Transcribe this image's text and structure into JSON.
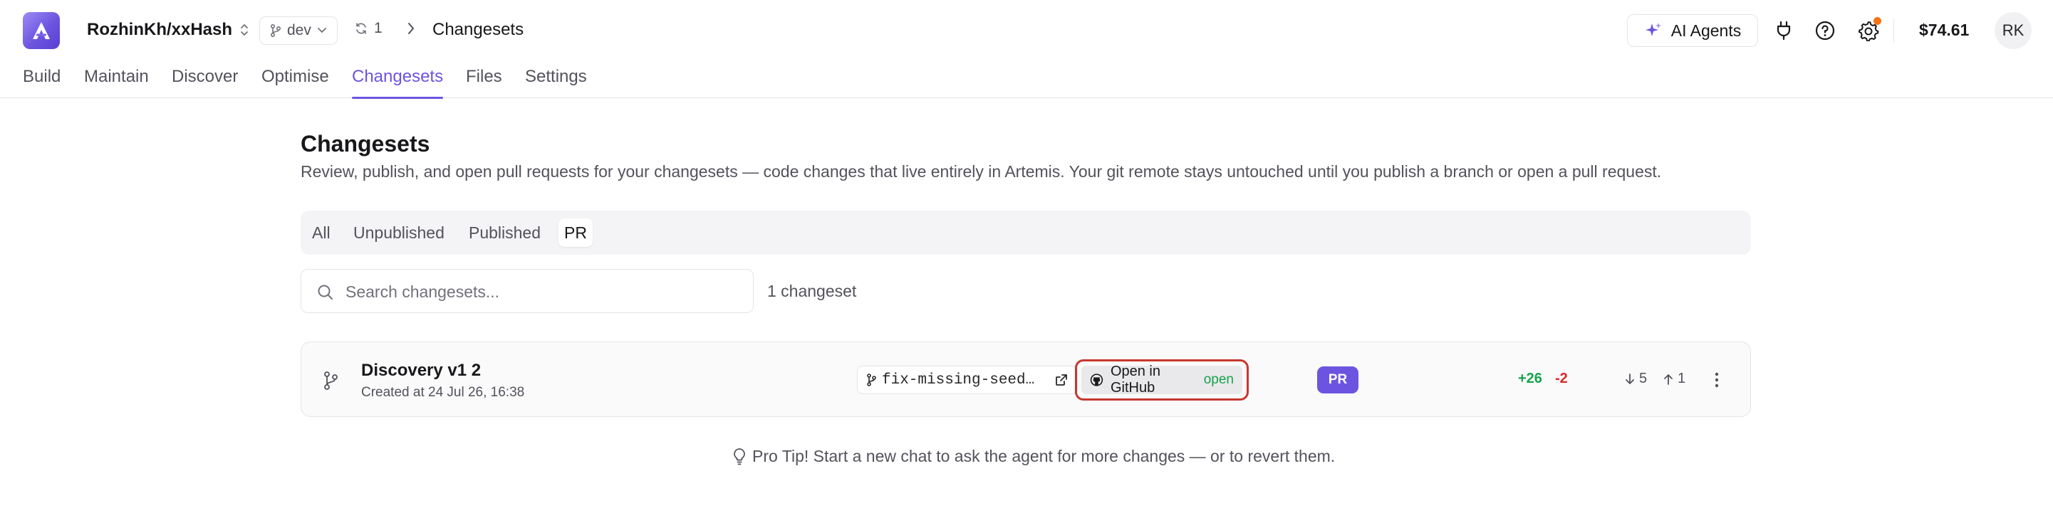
{
  "topbar": {
    "project_name": "RozhinKh/xxHash",
    "branch": "dev",
    "sync_count": "1",
    "breadcrumb_current": "Changesets",
    "ai_agents_label": "AI Agents",
    "balance": "$74.61",
    "avatar_initials": "RK",
    "notification_color": "#f97316"
  },
  "nav": {
    "tabs": [
      {
        "label": "Build"
      },
      {
        "label": "Maintain"
      },
      {
        "label": "Discover"
      },
      {
        "label": "Optimise"
      },
      {
        "label": "Changesets",
        "active": true
      },
      {
        "label": "Files"
      },
      {
        "label": "Settings"
      }
    ]
  },
  "main": {
    "title": "Changesets",
    "description": "Review, publish, and open pull requests for your changesets — code changes that live entirely in Artemis. Your git remote stays untouched until you publish a branch or open a pull request.",
    "filters": [
      {
        "label": "All"
      },
      {
        "label": "Unpublished"
      },
      {
        "label": "Published"
      },
      {
        "label": "PR",
        "active": true
      }
    ],
    "search_placeholder": "Search changesets...",
    "count_label": "1 changeset",
    "changesets": [
      {
        "title": "Discovery v1 2",
        "created": "Created at 24 Jul 26, 16:38",
        "branch": "fix-missing-seed…",
        "github_label": "Open in GitHub",
        "github_status": "open",
        "badge": "PR",
        "additions": "+26",
        "deletions": "-2",
        "behind": "5",
        "ahead": "1"
      }
    ],
    "tip": "Pro Tip! Start a new chat to ask the agent for more changes — or to revert them."
  },
  "colors": {
    "accent": "#6d54e0",
    "highlight_border": "#c7372f",
    "additions": "#16a34a",
    "deletions": "#dc2626"
  }
}
